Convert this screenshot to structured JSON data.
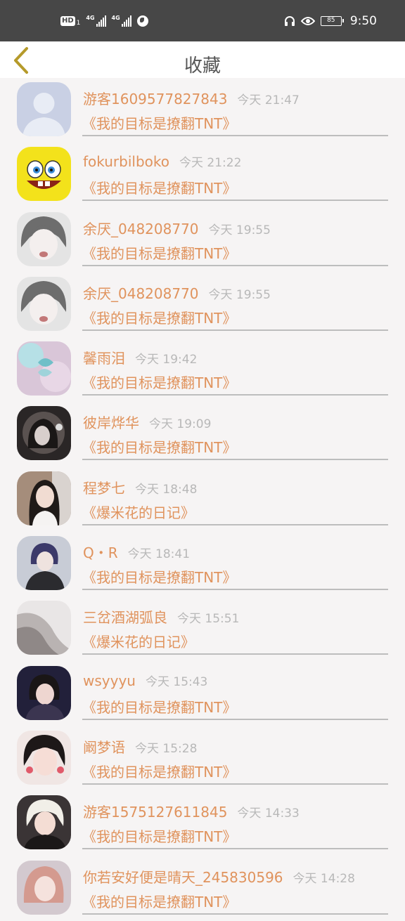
{
  "status_bar": {
    "hd": "HD",
    "sim1": "1",
    "net1": "4G",
    "net2": "4G",
    "battery": "85",
    "time": "9:50"
  },
  "header": {
    "title": "收藏"
  },
  "items": [
    {
      "name": "游客1609577827843",
      "time": "今天 21:47",
      "book": "《我的目标是撩翻TNT》"
    },
    {
      "name": "fokurbilboko",
      "time": "今天 21:22",
      "book": "《我的目标是撩翻TNT》"
    },
    {
      "name": "余厌_048208770",
      "time": "今天 19:55",
      "book": "《我的目标是撩翻TNT》"
    },
    {
      "name": "余厌_048208770",
      "time": "今天 19:55",
      "book": "《我的目标是撩翻TNT》"
    },
    {
      "name": "馨雨泪",
      "time": "今天 19:42",
      "book": "《我的目标是撩翻TNT》"
    },
    {
      "name": "彼岸烨华",
      "time": "今天 19:09",
      "book": "《我的目标是撩翻TNT》"
    },
    {
      "name": "程梦七",
      "time": "今天 18:48",
      "book": "《爆米花的日记》"
    },
    {
      "name": "Q・R",
      "time": "今天 18:41",
      "book": "《我的目标是撩翻TNT》"
    },
    {
      "name": "三岔酒湖弧良",
      "time": "今天 15:51",
      "book": "《爆米花的日记》"
    },
    {
      "name": "wsyyyu",
      "time": "今天 15:43",
      "book": "《我的目标是撩翻TNT》"
    },
    {
      "name": "阚梦语",
      "time": "今天 15:28",
      "book": "《我的目标是撩翻TNT》"
    },
    {
      "name": "游客1575127611845",
      "time": "今天 14:33",
      "book": "《我的目标是撩翻TNT》"
    },
    {
      "name": "你若安好便是晴天_245830596",
      "time": "今天 14:28",
      "book": "《我的目标是撩翻TNT》"
    }
  ],
  "colors": {
    "accent": "#e0935d",
    "back_arrow": "#b59a2a",
    "status_bar": "#474747"
  }
}
